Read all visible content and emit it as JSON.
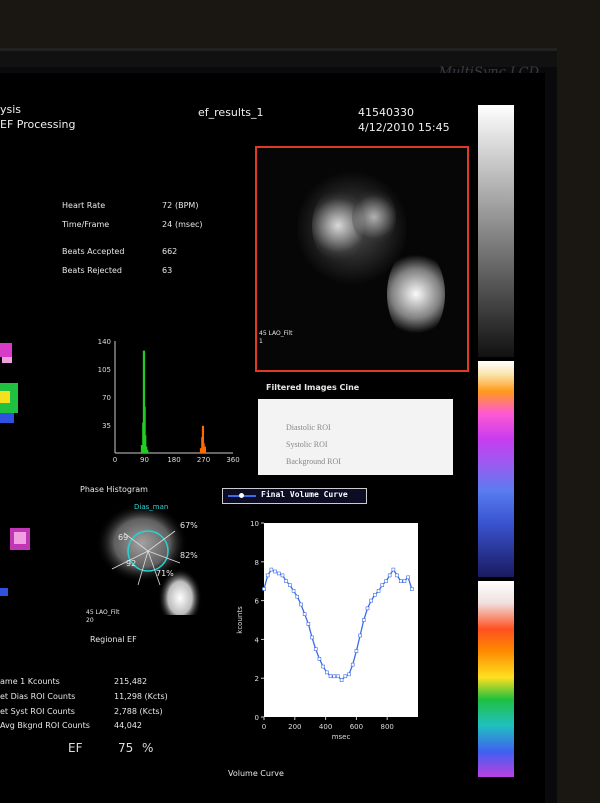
{
  "monitor": {
    "brand": "MultiSync LCD"
  },
  "header": {
    "title_line1": "ysis",
    "title_line2": "EF Processing",
    "dataset": "ef_results_1",
    "patient_id": "41540330",
    "datetime": "4/12/2010 15:45"
  },
  "stats": {
    "heart_rate_label": "Heart Rate",
    "heart_rate_value": "72",
    "heart_rate_unit": "(BPM)",
    "time_frame_label": "Time/Frame",
    "time_frame_value": "24",
    "time_frame_unit": "(msec)",
    "beats_accepted_label": "Beats Accepted",
    "beats_accepted_value": "662",
    "beats_rejected_label": "Beats Rejected",
    "beats_rejected_value": "63"
  },
  "cine_image": {
    "label": "45 LAO_Filt",
    "index": "1"
  },
  "cine_panel": {
    "title": "Filtered Images Cine",
    "items": [
      "Diastolic ROI",
      "Systolic ROI",
      "Background ROI"
    ]
  },
  "phase_histogram": {
    "title": "Phase Histogram",
    "y_ticks": [
      "140",
      "105",
      "70",
      "35"
    ],
    "x_ticks": [
      "0",
      "90",
      "180",
      "270",
      "360"
    ]
  },
  "regional_ef": {
    "roi_label": "Dias_man",
    "pct_top_right": "67%",
    "pct_right": "82%",
    "pct_left": "69",
    "pct_bottom_left": "92",
    "pct_bottom": "71%",
    "image_label": "45 LAO_Filt",
    "image_index": "20",
    "title": "Regional EF"
  },
  "counts": {
    "rows": [
      {
        "label": "ame 1 Kcounts",
        "value": "215,482"
      },
      {
        "label": "et Dias ROI Counts",
        "value": "11,298 (Kcts)"
      },
      {
        "label": "et Syst ROI Counts",
        "value": "2,788 (Kcts)"
      },
      {
        "label": "Avg Bkgnd ROI Counts",
        "value": "44,042"
      }
    ],
    "ef_label": "EF",
    "ef_value": "75",
    "ef_unit": "%"
  },
  "volume_legend": "Final Volume Curve",
  "volume_footer": "Volume Curve",
  "colors": {
    "roi_border": "#e03a24",
    "curve": "#3a6be8",
    "hist_green": "#22cc22",
    "hist_orange": "#ff6a00"
  },
  "chart_data": [
    {
      "type": "bar",
      "title": "Phase Histogram",
      "xlabel": "",
      "ylabel": "",
      "xlim": [
        0,
        360
      ],
      "ylim": [
        0,
        140
      ],
      "series": [
        {
          "color": "#22cc22",
          "points": [
            [
              82,
              10
            ],
            [
              86,
              38
            ],
            [
              88,
              128
            ],
            [
              90,
              58
            ],
            [
              92,
              22
            ],
            [
              95,
              8
            ],
            [
              98,
              4
            ]
          ]
        },
        {
          "color": "#ff6a00",
          "points": [
            [
              262,
              6
            ],
            [
              266,
              20
            ],
            [
              268,
              34
            ],
            [
              270,
              12
            ],
            [
              274,
              8
            ]
          ]
        }
      ]
    },
    {
      "type": "line",
      "title": "",
      "xlabel": "msec",
      "ylabel": "kcounts",
      "xlim": [
        0,
        1000
      ],
      "ylim": [
        0,
        10
      ],
      "x_ticks": [
        0,
        200,
        400,
        600,
        800
      ],
      "y_ticks": [
        0,
        2,
        4,
        6,
        8,
        10
      ],
      "series": [
        {
          "name": "Final Volume Curve",
          "x": [
            0,
            24,
            48,
            72,
            96,
            120,
            144,
            168,
            192,
            216,
            240,
            264,
            288,
            312,
            336,
            360,
            384,
            408,
            432,
            456,
            480,
            504,
            528,
            552,
            576,
            600,
            624,
            648,
            672,
            696,
            720,
            744,
            768,
            792,
            816,
            840,
            864,
            888,
            912,
            936,
            960
          ],
          "y": [
            6.6,
            7.3,
            7.6,
            7.5,
            7.4,
            7.3,
            7.0,
            6.8,
            6.5,
            6.2,
            5.8,
            5.3,
            4.8,
            4.1,
            3.5,
            3.0,
            2.6,
            2.3,
            2.1,
            2.1,
            2.1,
            1.9,
            2.1,
            2.2,
            2.7,
            3.4,
            4.2,
            5.0,
            5.6,
            6.0,
            6.3,
            6.5,
            6.8,
            7.0,
            7.3,
            7.6,
            7.3,
            7.0,
            7.0,
            7.2,
            6.6
          ]
        }
      ]
    }
  ]
}
